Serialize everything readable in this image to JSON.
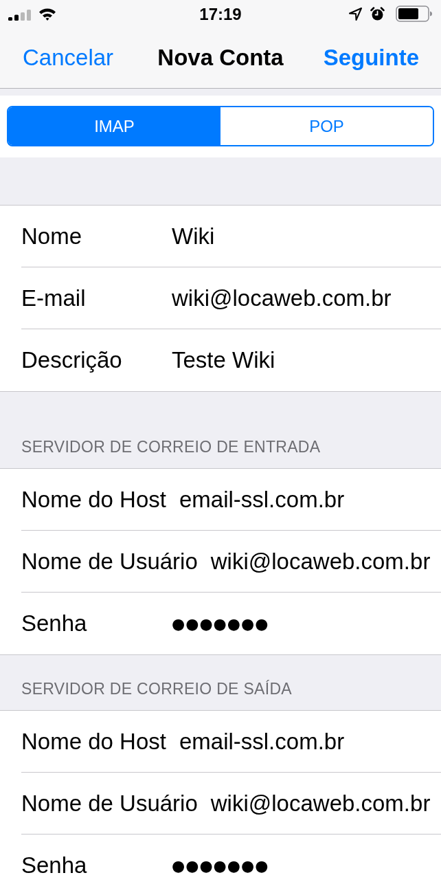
{
  "status_bar": {
    "time": "17:19"
  },
  "nav": {
    "cancel": "Cancelar",
    "title": "Nova Conta",
    "next": "Seguinte"
  },
  "segmented": [
    {
      "label": "IMAP",
      "selected": true
    },
    {
      "label": "POP",
      "selected": false
    }
  ],
  "account": [
    {
      "label": "Nome",
      "value": "Wiki",
      "kind": "text"
    },
    {
      "label": "E-mail",
      "value": "wiki@locaweb.com.br",
      "kind": "text"
    },
    {
      "label": "Descrição",
      "value": "Teste Wiki",
      "kind": "text"
    }
  ],
  "sections": [
    {
      "header": "SERVIDOR DE CORREIO DE ENTRADA",
      "rows": [
        {
          "label": "Nome do Host",
          "value": "email-ssl.com.br",
          "kind": "text"
        },
        {
          "label": "Nome de Usuário",
          "value": "wiki@locaweb.com.br",
          "kind": "text"
        },
        {
          "label": "Senha",
          "value": "●●●●●●●",
          "kind": "password"
        }
      ]
    },
    {
      "header": "SERVIDOR DE CORREIO DE SAÍDA",
      "rows": [
        {
          "label": "Nome do Host",
          "value": "email-ssl.com.br",
          "kind": "text"
        },
        {
          "label": "Nome de Usuário",
          "value": "wiki@locaweb.com.br",
          "kind": "text"
        },
        {
          "label": "Senha",
          "value": "●●●●●●●",
          "kind": "password"
        }
      ]
    }
  ]
}
